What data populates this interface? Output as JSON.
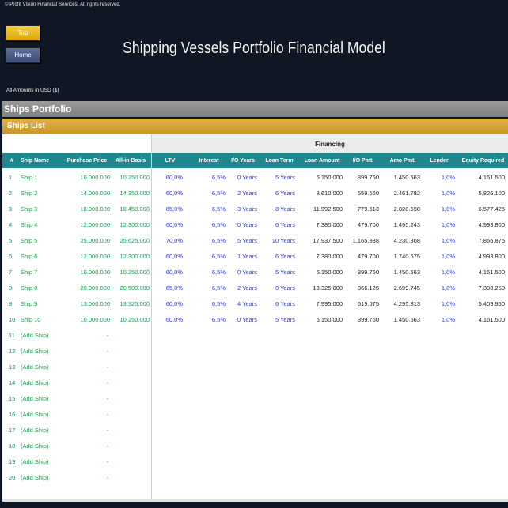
{
  "copyright": "© Profit Vision Financial Services. All rights reserved.",
  "nav": {
    "top_label": "Top",
    "home_label": "Home"
  },
  "title": "Shipping Vessels Portfolio Financial Model",
  "amounts_note": "All Amounts in  USD ($)",
  "section_portfolio": "Ships Portfolio",
  "section_list": "Ships List",
  "financing_header": "Financing",
  "columns": [
    "#",
    "Ship Name",
    "Purchase Price",
    "All-in Basis",
    "LTV",
    "Interest Rate",
    "I/O Years",
    "Loan Term",
    "Loan Amount",
    "I/O Pmt.",
    "Amo Pmt.",
    "Lender Fees",
    "Equity Required"
  ],
  "ships": [
    {
      "n": "1",
      "name": "Ship 1",
      "price": "10.000.000",
      "basis": "10.250.000",
      "ltv": "60,0%",
      "rate": "6,5%",
      "io": "0 Years",
      "term": "5 Years",
      "loan": "6.150.000",
      "iopmt": "399.750",
      "amopmt": "1.450.563",
      "fees": "1,0%",
      "equity": "4.161.500"
    },
    {
      "n": "2",
      "name": "Ship 2",
      "price": "14.000.000",
      "basis": "14.350.000",
      "ltv": "60,0%",
      "rate": "6,5%",
      "io": "2 Years",
      "term": "6 Years",
      "loan": "8.610.000",
      "iopmt": "559.650",
      "amopmt": "2.461.782",
      "fees": "1,0%",
      "equity": "5.826.100"
    },
    {
      "n": "3",
      "name": "Ship 3",
      "price": "18.000.000",
      "basis": "18.450.000",
      "ltv": "65,0%",
      "rate": "6,5%",
      "io": "3 Years",
      "term": "8 Years",
      "loan": "11.992.500",
      "iopmt": "779.513",
      "amopmt": "2.828.598",
      "fees": "1,0%",
      "equity": "6.577.425"
    },
    {
      "n": "4",
      "name": "Ship 4",
      "price": "12.000.000",
      "basis": "12.300.000",
      "ltv": "60,0%",
      "rate": "6,5%",
      "io": "0 Years",
      "term": "6 Years",
      "loan": "7.380.000",
      "iopmt": "479.700",
      "amopmt": "1.495.243",
      "fees": "1,0%",
      "equity": "4.993.800"
    },
    {
      "n": "5",
      "name": "Ship 5",
      "price": "25.000.000",
      "basis": "25.625.000",
      "ltv": "70,0%",
      "rate": "6,5%",
      "io": "5 Years",
      "term": "10 Years",
      "loan": "17.937.500",
      "iopmt": "1.165.938",
      "amopmt": "4.230.808",
      "fees": "1,0%",
      "equity": "7.866.875"
    },
    {
      "n": "6",
      "name": "Ship 6",
      "price": "12.000.000",
      "basis": "12.300.000",
      "ltv": "60,0%",
      "rate": "6,5%",
      "io": "1 Years",
      "term": "6 Years",
      "loan": "7.380.000",
      "iopmt": "479.700",
      "amopmt": "1.740.675",
      "fees": "1,0%",
      "equity": "4.993.800"
    },
    {
      "n": "7",
      "name": "Ship 7",
      "price": "10.000.000",
      "basis": "10.250.000",
      "ltv": "60,0%",
      "rate": "6,5%",
      "io": "0 Years",
      "term": "5 Years",
      "loan": "6.150.000",
      "iopmt": "399.750",
      "amopmt": "1.450.563",
      "fees": "1,0%",
      "equity": "4.161.500"
    },
    {
      "n": "8",
      "name": "Ship 8",
      "price": "20.000.000",
      "basis": "20.500.000",
      "ltv": "65,0%",
      "rate": "6,5%",
      "io": "2 Years",
      "term": "8 Years",
      "loan": "13.325.000",
      "iopmt": "866.125",
      "amopmt": "2.699.745",
      "fees": "1,0%",
      "equity": "7.308.250"
    },
    {
      "n": "9",
      "name": "Ship 9",
      "price": "13.000.000",
      "basis": "13.325.000",
      "ltv": "60,0%",
      "rate": "6,5%",
      "io": "4 Years",
      "term": "6 Years",
      "loan": "7.995.000",
      "iopmt": "519.675",
      "amopmt": "4.295.313",
      "fees": "1,0%",
      "equity": "5.409.950"
    },
    {
      "n": "10",
      "name": "Ship 10",
      "price": "10.000.000",
      "basis": "10.250.000",
      "ltv": "60,0%",
      "rate": "6,5%",
      "io": "0 Years",
      "term": "5 Years",
      "loan": "6.150.000",
      "iopmt": "399.750",
      "amopmt": "1.450.563",
      "fees": "1,0%",
      "equity": "4.161.500"
    },
    {
      "n": "11",
      "name": "(Add Ship)",
      "basis": "-"
    },
    {
      "n": "12",
      "name": "(Add Ship)",
      "basis": "-"
    },
    {
      "n": "13",
      "name": "(Add Ship)",
      "basis": "-"
    },
    {
      "n": "14",
      "name": "(Add Ship)",
      "basis": "-"
    },
    {
      "n": "15",
      "name": "(Add Ship)",
      "basis": "-"
    },
    {
      "n": "16",
      "name": "(Add Ship)",
      "basis": "-"
    },
    {
      "n": "17",
      "name": "(Add Ship)",
      "basis": "-"
    },
    {
      "n": "18",
      "name": "(Add Ship)",
      "basis": "-"
    },
    {
      "n": "19",
      "name": "(Add Ship)",
      "basis": "-"
    },
    {
      "n": "20",
      "name": "(Add Ship)",
      "basis": "-"
    }
  ]
}
